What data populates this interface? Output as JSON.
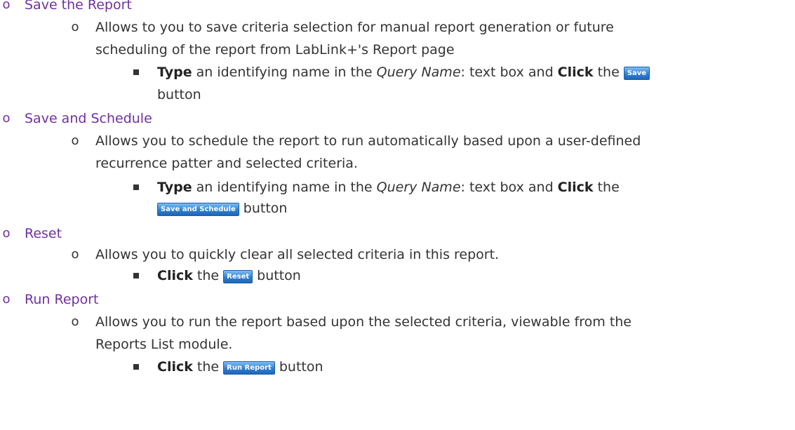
{
  "sections": [
    {
      "title": "Save the Report",
      "description_line1": "Allows to you to save criteria selection for manual report generation or future",
      "description_line2": "scheduling of the report from LabLink+'s Report page",
      "step": {
        "type_word": "Type",
        "text_a": " an identifying name in the ",
        "field": "Query Name",
        "text_b": ": text box and ",
        "click_word": "Click",
        "text_c": " the ",
        "button_label": "Save",
        "after_button": "button"
      }
    },
    {
      "title": "Save and Schedule",
      "description_line1": "Allows you to schedule the report to run automatically based upon a user-defined",
      "description_line2": "recurrence patter and selected criteria.",
      "step": {
        "type_word": "Type",
        "text_a": " an identifying name in the ",
        "field": "Query Name",
        "text_b": ": text box and ",
        "click_word": "Click",
        "text_c": " the",
        "button_label": "Save and Schedule",
        "after_button": " button"
      }
    },
    {
      "title": "Reset",
      "description_line1": "Allows you to quickly clear all selected criteria in this report.",
      "step": {
        "click_word": "Click",
        "text_c": " the ",
        "button_label": "Reset",
        "after_button": " button"
      }
    },
    {
      "title": "Run Report",
      "description_line1": "Allows you to run the report based upon the selected criteria, viewable from the",
      "description_line2": "Reports List module.",
      "step": {
        "click_word": "Click",
        "text_c": " the ",
        "button_label": "Run Report",
        "after_button": " button"
      }
    }
  ],
  "bullet_glyph": "o",
  "colors": {
    "heading": "#7030a0",
    "body": "#333333",
    "button_fill": "#2f80d0"
  }
}
